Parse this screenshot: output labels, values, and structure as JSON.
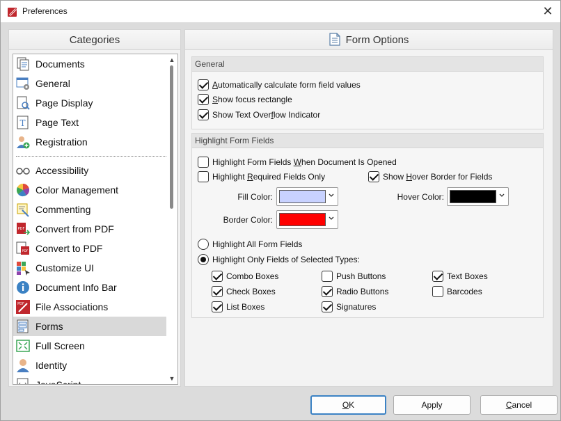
{
  "window": {
    "title": "Preferences",
    "close_glyph": "✕"
  },
  "categories": {
    "header": "Categories",
    "group1": [
      {
        "label": "Documents",
        "icon": "documents-icon"
      },
      {
        "label": "General",
        "icon": "general-icon"
      },
      {
        "label": "Page Display",
        "icon": "page-display-icon"
      },
      {
        "label": "Page Text",
        "icon": "page-text-icon"
      },
      {
        "label": "Registration",
        "icon": "registration-icon"
      }
    ],
    "group2": [
      {
        "label": "Accessibility",
        "icon": "accessibility-icon"
      },
      {
        "label": "Color Management",
        "icon": "color-management-icon"
      },
      {
        "label": "Commenting",
        "icon": "commenting-icon"
      },
      {
        "label": "Convert from PDF",
        "icon": "convert-from-pdf-icon"
      },
      {
        "label": "Convert to PDF",
        "icon": "convert-to-pdf-icon"
      },
      {
        "label": "Customize UI",
        "icon": "customize-ui-icon"
      },
      {
        "label": "Document Info Bar",
        "icon": "info-icon"
      },
      {
        "label": "File Associations",
        "icon": "file-associations-icon"
      },
      {
        "label": "Forms",
        "icon": "forms-icon",
        "selected": true
      },
      {
        "label": "Full Screen",
        "icon": "full-screen-icon"
      },
      {
        "label": "Identity",
        "icon": "identity-icon"
      },
      {
        "label": "JavaScript",
        "icon": "javascript-icon"
      }
    ]
  },
  "form_options": {
    "header": "Form Options",
    "general": {
      "title": "General",
      "auto_calc": {
        "prefix": "",
        "ul": "A",
        "rest": "utomatically calculate form field values",
        "checked": true
      },
      "focus_rect": {
        "prefix": "",
        "ul": "S",
        "rest": "how focus rectangle",
        "checked": true
      },
      "overflow": {
        "prefix": "Show Text Over",
        "ul": "f",
        "rest": "low Indicator",
        "checked": true
      }
    },
    "highlight": {
      "title": "Highlight Form Fields",
      "when_opened": {
        "prefix": "Highlight Form Fields ",
        "ul": "W",
        "rest": "hen Document Is Opened",
        "checked": false
      },
      "required_only": {
        "prefix": "Highlight ",
        "ul": "R",
        "rest": "equired Fields Only",
        "checked": false
      },
      "hover_border": {
        "prefix": "Show ",
        "ul": "H",
        "rest": "over Border for Fields",
        "checked": true
      },
      "fill_color_label": "Fill Color:",
      "fill_color": "#c8d2ff",
      "border_color_label": "Border Color:",
      "border_color": "#ff0000",
      "hover_color_label": "Hover Color:",
      "hover_color": "#000000",
      "all_fields": {
        "label": "Highlight All Form Fields",
        "selected": false
      },
      "selected_types": {
        "label": "Highlight Only Fields of Selected Types:",
        "selected": true
      },
      "types": {
        "combo_boxes": {
          "label": "Combo Boxes",
          "checked": true
        },
        "check_boxes": {
          "label": "Check Boxes",
          "checked": true
        },
        "list_boxes": {
          "label": "List Boxes",
          "checked": true
        },
        "push_buttons": {
          "label": "Push Buttons",
          "checked": false
        },
        "radio_buttons": {
          "label": "Radio Buttons",
          "checked": true
        },
        "signatures": {
          "label": "Signatures",
          "checked": true
        },
        "text_boxes": {
          "label": "Text Boxes",
          "checked": true
        },
        "barcodes": {
          "label": "Barcodes",
          "checked": false
        }
      }
    }
  },
  "buttons": {
    "ok": {
      "ul": "O",
      "rest": "K"
    },
    "apply": {
      "label": "Apply"
    },
    "cancel": {
      "ul": "C",
      "rest": "ancel"
    }
  },
  "colors": {
    "accent": "#3b82c4",
    "brand_red": "#c0272d"
  }
}
